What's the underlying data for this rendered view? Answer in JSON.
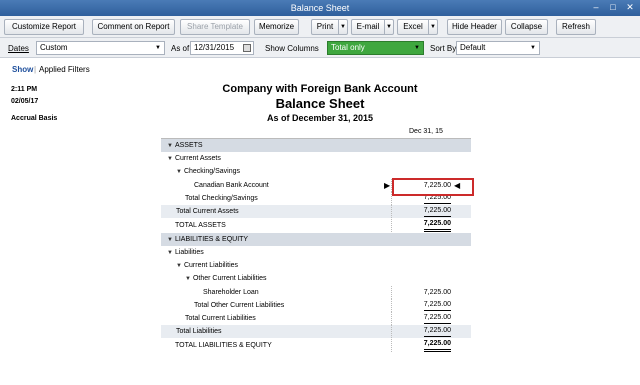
{
  "window": {
    "title": "Balance Sheet"
  },
  "toolbar": {
    "customize": "Customize Report",
    "comment": "Comment on Report",
    "share": "Share Template",
    "memorize": "Memorize",
    "print": "Print",
    "email": "E-mail",
    "excel": "Excel",
    "hide_header": "Hide Header",
    "collapse": "Collapse",
    "refresh": "Refresh"
  },
  "filters": {
    "dates_label": "Dates",
    "dates_value": "Custom",
    "as_of_label": "As of",
    "as_of_value": "12/31/2015",
    "show_columns_label": "Show Columns",
    "show_columns_value": "Total only",
    "sort_by_label": "Sort By",
    "sort_by_value": "Default"
  },
  "filterbar": {
    "show": "Show",
    "applied": "Applied Filters"
  },
  "info": {
    "time": "2:11 PM",
    "date": "02/05/17",
    "basis": "Accrual Basis"
  },
  "report": {
    "company": "Company with Foreign Bank Account",
    "title": "Balance Sheet",
    "subtitle": "As of December 31, 2015",
    "column_header": "Dec 31, 15",
    "rows": [
      {
        "label": "ASSETS",
        "value": ""
      },
      {
        "label": "Current Assets",
        "value": ""
      },
      {
        "label": "Checking/Savings",
        "value": ""
      },
      {
        "label": "Canadian Bank Account",
        "value": "7,225.00"
      },
      {
        "label": "Total Checking/Savings",
        "value": "7,225.00"
      },
      {
        "label": "Total Current Assets",
        "value": "7,225.00"
      },
      {
        "label": "TOTAL ASSETS",
        "value": "7,225.00"
      },
      {
        "label": "LIABILITIES & EQUITY",
        "value": ""
      },
      {
        "label": "Liabilities",
        "value": ""
      },
      {
        "label": "Current Liabilities",
        "value": ""
      },
      {
        "label": "Other Current Liabilities",
        "value": ""
      },
      {
        "label": "Shareholder Loan",
        "value": "7,225.00"
      },
      {
        "label": "Total Other Current Liabilities",
        "value": "7,225.00"
      },
      {
        "label": "Total Current Liabilities",
        "value": "7,225.00"
      },
      {
        "label": "Total Liabilities",
        "value": "7,225.00"
      },
      {
        "label": "TOTAL LIABILITIES & EQUITY",
        "value": "7,225.00"
      }
    ]
  }
}
